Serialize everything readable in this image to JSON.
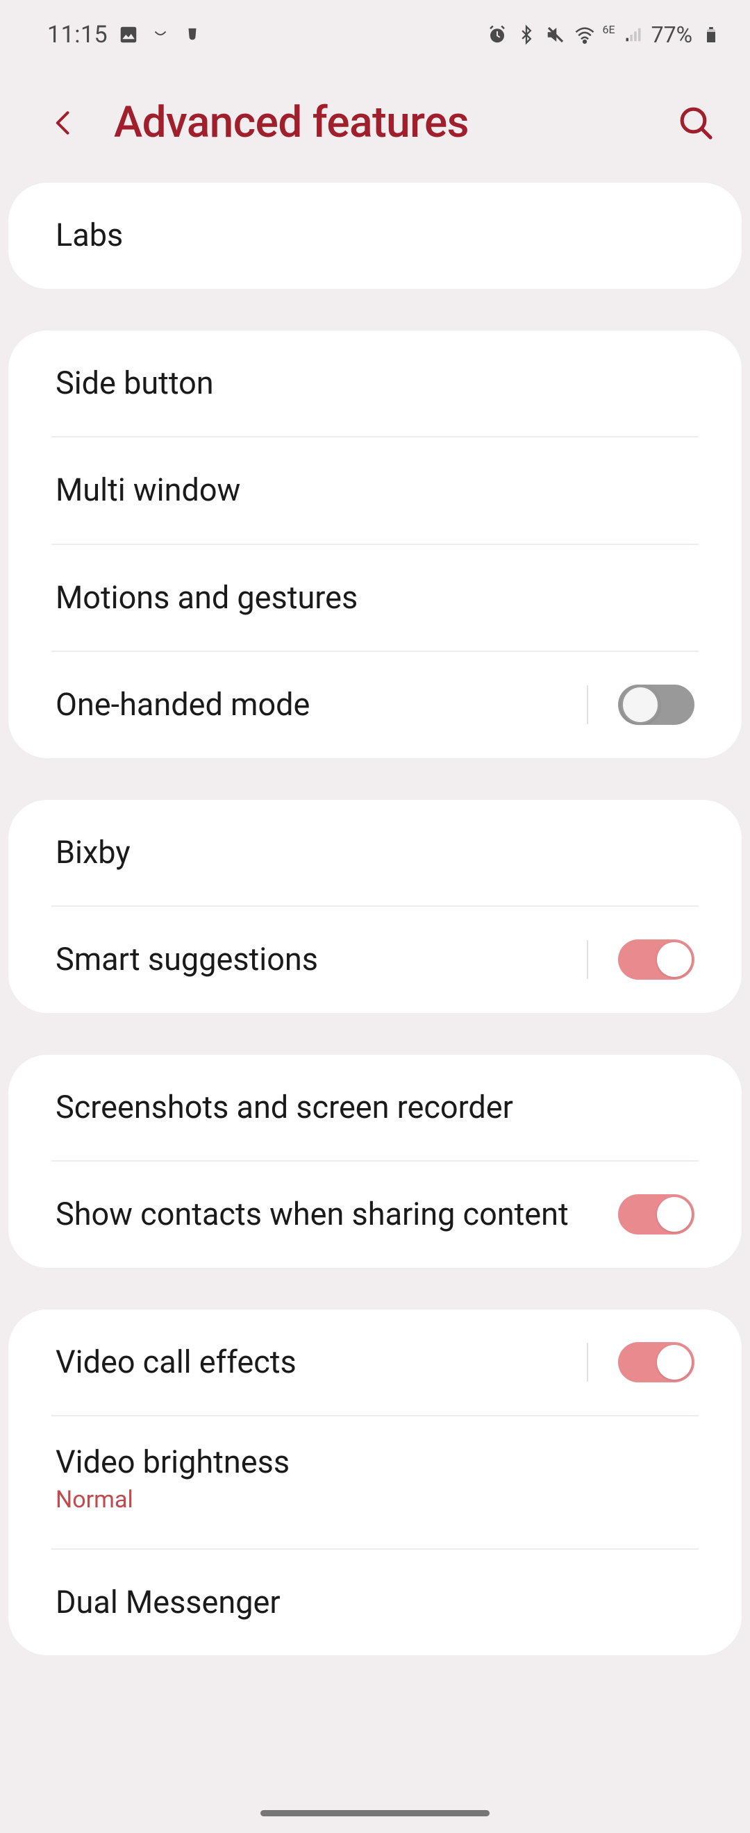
{
  "statusBar": {
    "time": "11:15",
    "battery": "77%"
  },
  "header": {
    "title": "Advanced features"
  },
  "groups": [
    {
      "items": [
        {
          "label": "Labs",
          "toggle": null
        }
      ]
    },
    {
      "items": [
        {
          "label": "Side button",
          "toggle": null
        },
        {
          "label": "Multi window",
          "toggle": null
        },
        {
          "label": "Motions and gestures",
          "toggle": null
        },
        {
          "label": "One-handed mode",
          "toggle": false,
          "hasDivider": true
        }
      ]
    },
    {
      "items": [
        {
          "label": "Bixby",
          "toggle": null
        },
        {
          "label": "Smart suggestions",
          "toggle": true,
          "hasDivider": true
        }
      ]
    },
    {
      "items": [
        {
          "label": "Screenshots and screen recorder",
          "toggle": null
        },
        {
          "label": "Show contacts when sharing content",
          "toggle": true
        }
      ]
    },
    {
      "items": [
        {
          "label": "Video call effects",
          "toggle": true,
          "hasDivider": true
        },
        {
          "label": "Video brightness",
          "sublabel": "Normal",
          "toggle": null
        },
        {
          "label": "Dual Messenger",
          "toggle": null
        }
      ]
    }
  ]
}
